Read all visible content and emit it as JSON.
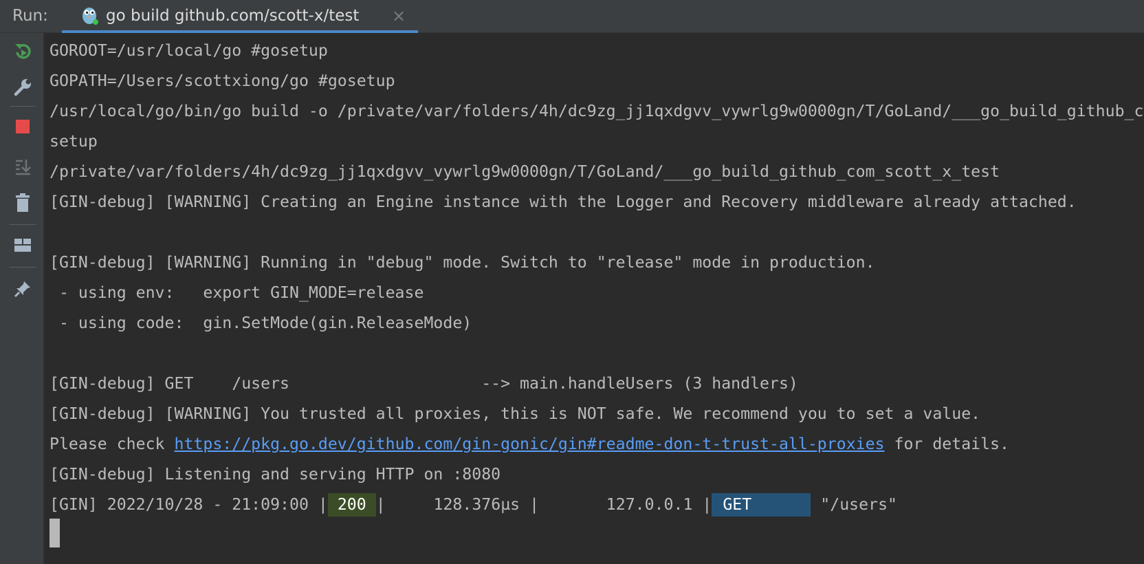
{
  "header": {
    "run_label": "Run:",
    "tab_title": "go build github.com/scott-x/test",
    "tab_close": "×"
  },
  "toolbar": {
    "items": [
      "rerun-icon",
      "wrench-icon",
      "stop-icon",
      "scroll-to-end-icon",
      "trash-icon",
      "layout-icon",
      "pin-icon"
    ]
  },
  "colors": {
    "background": "#2b2b2b",
    "text": "#bbbbbb",
    "link": "#589df6",
    "status_200_bg": "#3b4d26",
    "get_bg": "#255378",
    "tab_underline": "#4a88c7"
  },
  "console": {
    "lines": [
      "GOROOT=/usr/local/go #gosetup",
      "GOPATH=/Users/scottxiong/go #gosetup",
      "/usr/local/go/bin/go build -o /private/var/folders/4h/dc9zg_jj1qxdgvv_vywrlg9w0000gn/T/GoLand/___go_build_github_com_scott_x_test github.com/scott-x/test #go",
      "setup",
      "/private/var/folders/4h/dc9zg_jj1qxdgvv_vywrlg9w0000gn/T/GoLand/___go_build_github_com_scott_x_test",
      "[GIN-debug] [WARNING] Creating an Engine instance with the Logger and Recovery middleware already attached.",
      "",
      "[GIN-debug] [WARNING] Running in \"debug\" mode. Switch to \"release\" mode in production.",
      " - using env:   export GIN_MODE=release",
      " - using code:  gin.SetMode(gin.ReleaseMode)",
      "",
      "[GIN-debug] GET    /users                    --> main.handleUsers (3 handlers)",
      "[GIN-debug] [WARNING] You trusted all proxies, this is NOT safe. We recommend you to set a value."
    ],
    "please_check_prefix": "Please check ",
    "docs_link": "https://pkg.go.dev/github.com/gin-gonic/gin#readme-don-t-trust-all-proxies",
    "please_check_suffix": " for details.",
    "listening_line": "[GIN-debug] Listening and serving HTTP on :8080",
    "request_log": {
      "prefix": "[GIN] 2022/10/28 - 21:09:00 |",
      "status": "200",
      "middle": "|     128.376µs |       127.0.0.1 |",
      "method": "GET",
      "path": " \"/users\""
    }
  }
}
